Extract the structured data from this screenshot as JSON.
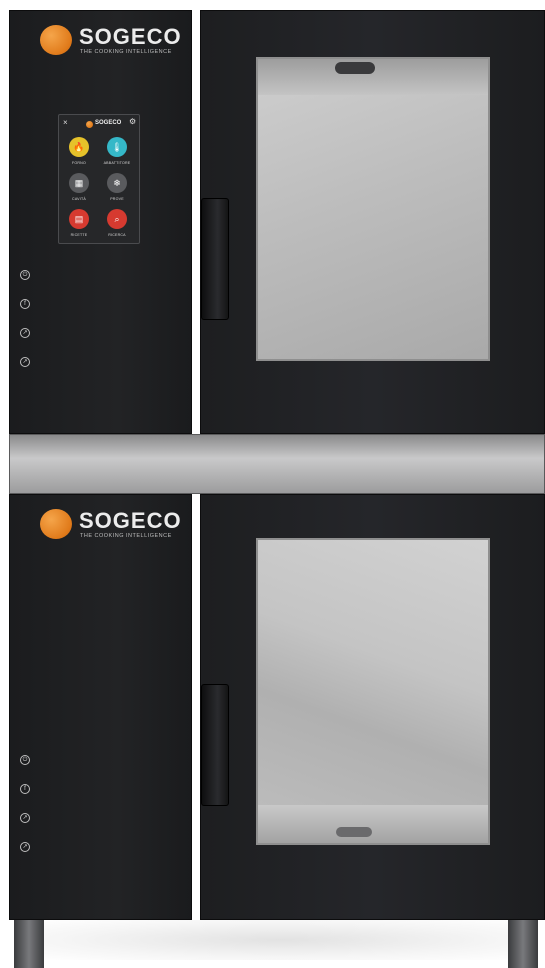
{
  "brand": {
    "name": "SOGECO",
    "tagline": "THE COOKING INTELLIGENCE",
    "accent": "#e07a1a"
  },
  "touchscreen": {
    "close_glyph": "×",
    "settings_glyph": "⚙",
    "apps": [
      {
        "label": "FORNO",
        "icon": "flame-icon",
        "glyph": "🔥",
        "color": "#e6c22a"
      },
      {
        "label": "ABBATTITORE",
        "icon": "thermometer-icon",
        "glyph": "🌡",
        "color": "#35b8c8"
      },
      {
        "label": "CAVITÀ",
        "icon": "cavity-icon",
        "glyph": "▦",
        "color": "#5a5b5e"
      },
      {
        "label": "PROVE",
        "icon": "snowflake-icon",
        "glyph": "❄",
        "color": "#5a5b5e"
      },
      {
        "label": "RICETTE",
        "icon": "book-icon",
        "glyph": "▤",
        "color": "#d63a30"
      },
      {
        "label": "RICERCA",
        "icon": "search-icon",
        "glyph": "⌕",
        "color": "#d63a30"
      }
    ]
  },
  "controls": [
    {
      "name": "power",
      "glyph": "⏻"
    },
    {
      "name": "fan",
      "glyph": "f"
    },
    {
      "name": "temp",
      "glyph": "↗"
    },
    {
      "name": "light",
      "glyph": "↗"
    }
  ]
}
